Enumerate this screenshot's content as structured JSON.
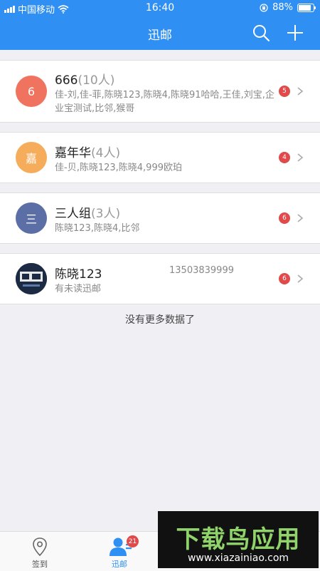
{
  "status_bar": {
    "carrier": "中国移动",
    "time": "16:40",
    "battery_pct": "88%",
    "battery_level": 0.88
  },
  "header": {
    "title": "迅邮",
    "search_icon": "search-icon",
    "add_icon": "plus-icon"
  },
  "conversations": [
    {
      "avatar_text": "6",
      "avatar_color": "#f0735f",
      "name": "666",
      "count": "(10人)",
      "members": "佳-刘,佳-菲,陈晓123,陈晓4,陈晓91哈哈,王佳,刘宝,企业宝测试,比邻,猴哥",
      "unread": "5"
    },
    {
      "avatar_text": "嘉",
      "avatar_color": "#f5ad5c",
      "name": "嘉年华",
      "count": "(4人)",
      "members": "佳-贝,陈晓123,陈晓4,999欧珀",
      "unread": "4"
    },
    {
      "avatar_text": "三",
      "avatar_color": "#5b6ea6",
      "name": "三人组",
      "count": "(3人)",
      "members": "陈晓123,陈晓4,比邻",
      "unread": "6"
    },
    {
      "avatar_text": "",
      "avatar_color": "#1c2a44",
      "name": "陈晓123",
      "phone": "13503839999",
      "members": "有未读迅邮",
      "unread": "6"
    }
  ],
  "footer_text": "没有更多数据了",
  "tabbar": {
    "tabs": [
      {
        "label": "签到",
        "icon": "location-pin-icon",
        "active": false
      },
      {
        "label": "迅邮",
        "icon": "contacts-icon",
        "active": true,
        "badge": "21"
      }
    ]
  },
  "watermark": {
    "logo": "下载鸟应用",
    "url": "www.xiazainiao.com"
  },
  "colors": {
    "brand": "#2f8ff3",
    "badge": "#e04a4a"
  }
}
